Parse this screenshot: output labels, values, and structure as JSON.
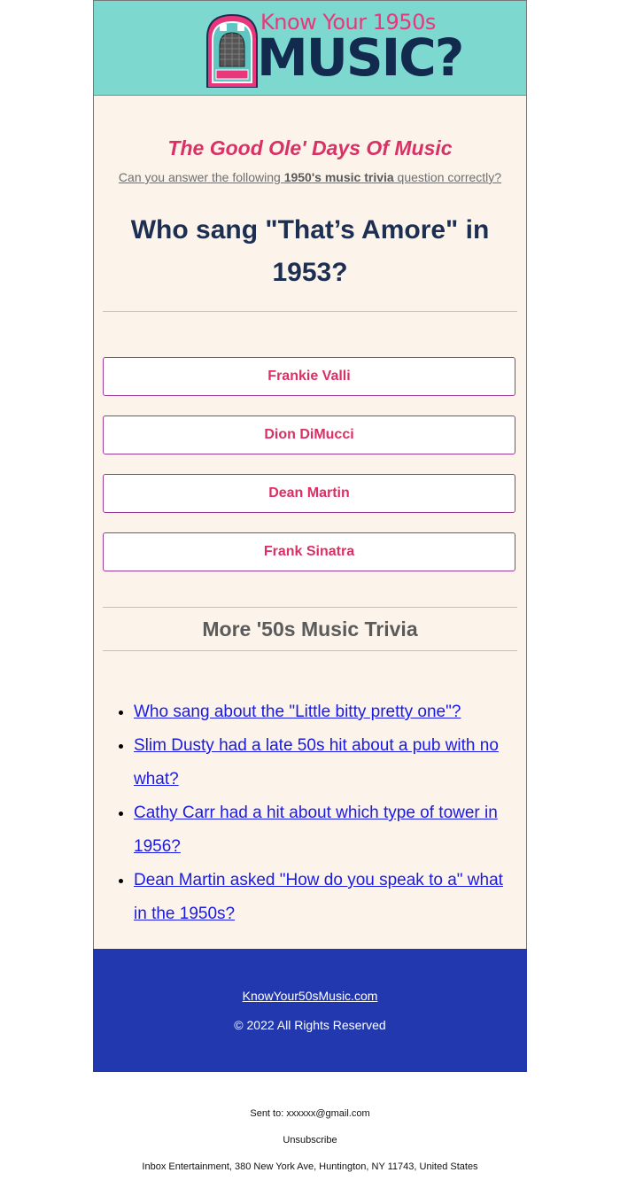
{
  "header": {
    "logo_top_text": "Know Your 1950s",
    "logo_main_text": "MUSIC?",
    "logo_icon": "jukebox-icon",
    "background_color": "#7dd8cf"
  },
  "tagline": "The Good Ole' Days Of Music",
  "subline": {
    "prefix": "Can you answer the following ",
    "bold": "1950's music trivia",
    "suffix": " question correctly?"
  },
  "question": "Who sang \"That’s Amore\" in 1953?",
  "answers": [
    {
      "label": "Frankie Valli"
    },
    {
      "label": "Dion DiMucci"
    },
    {
      "label": "Dean Martin"
    },
    {
      "label": "Frank Sinatra"
    }
  ],
  "more": {
    "title": "More '50s Music Trivia",
    "links": [
      {
        "text": "Who sang about the \"Little bitty pretty one\"? "
      },
      {
        "text": "Slim Dusty had a late 50s hit about a pub with no what? "
      },
      {
        "text": "Cathy Carr had a hit about which type of tower in 1956?"
      },
      {
        "text": "Dean Martin asked \"How do you speak to a\" what in the 1950s? "
      }
    ]
  },
  "footer": {
    "site_link": "KnowYour50sMusic.com",
    "copyright": "© 2022 All Rights Reserved",
    "background_color": "#2138ae"
  },
  "bottom": {
    "sent_to": "Sent to: xxxxxx@gmail.com",
    "unsubscribe": "Unsubscribe",
    "address": "Inbox Entertainment, 380 New York Ave, Huntington, NY 11743, United States"
  },
  "colors": {
    "accent": "#d93065",
    "question": "#1c2f53",
    "body_bg": "#fcf4ea",
    "link": "#1a1ae6"
  }
}
